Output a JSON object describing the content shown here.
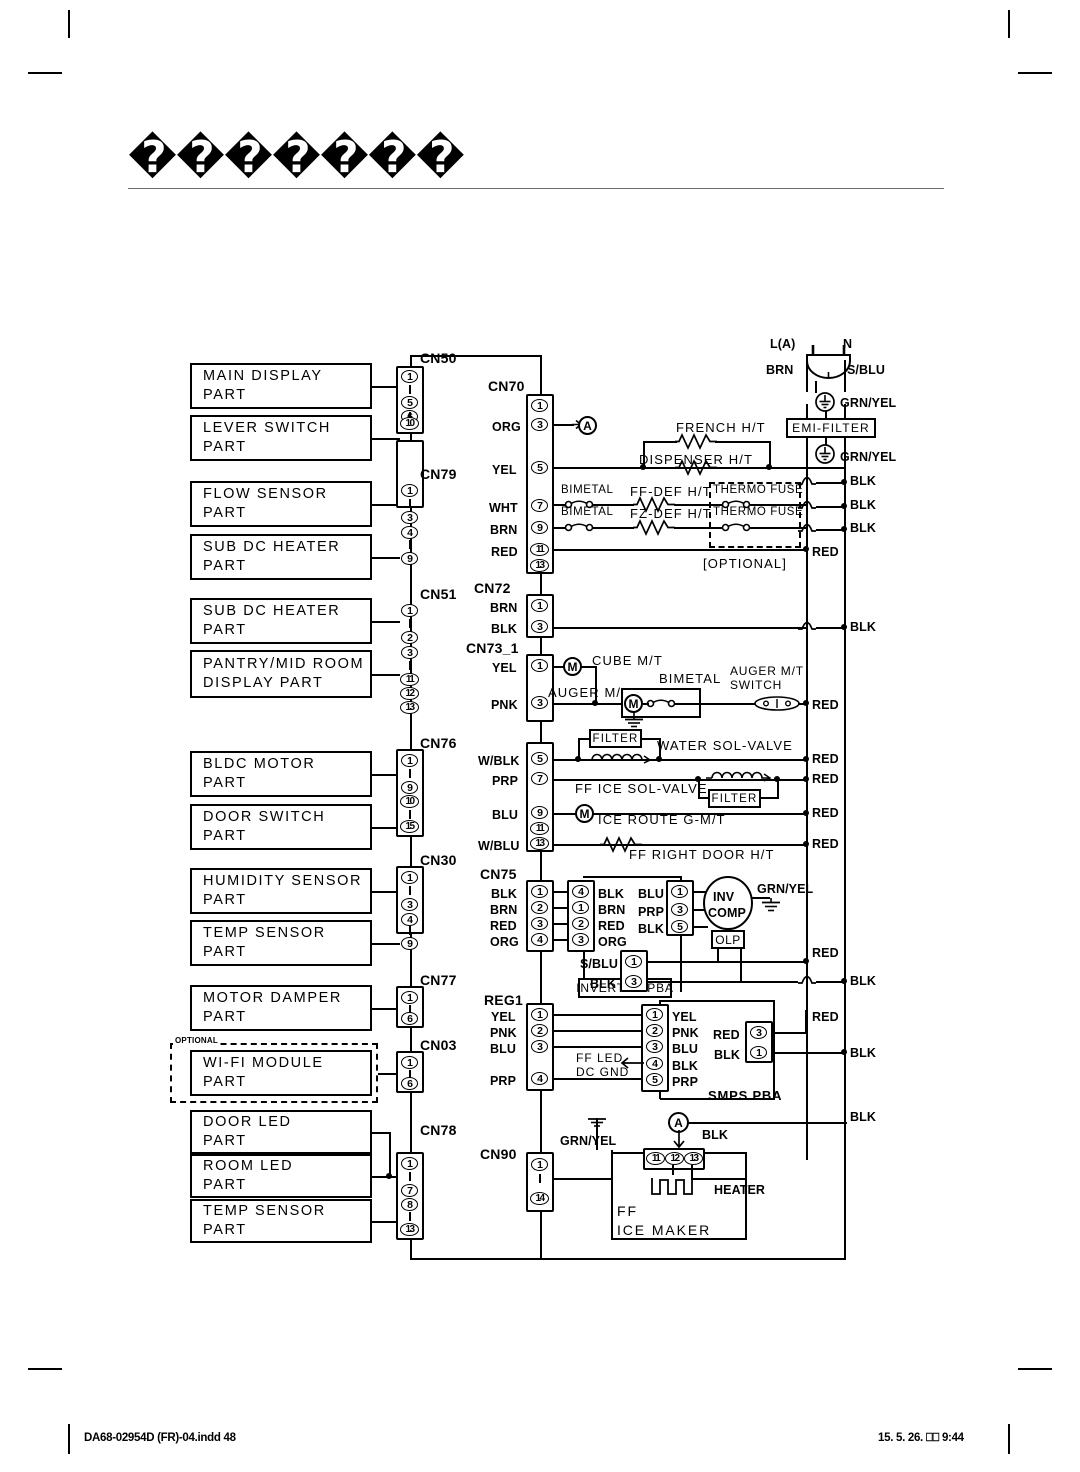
{
  "page": {
    "title": "�������",
    "footer_left": "DA68-02954D (FR)-04.indd   48",
    "footer_right": "15. 5. 26.  ⎕⎕ 9:44"
  },
  "left_parts": [
    {
      "line1": "MAIN DISPLAY",
      "line2": "PART"
    },
    {
      "line1": "LEVER SWITCH",
      "line2": "PART"
    },
    {
      "line1": "FLOW SENSOR",
      "line2": "PART"
    },
    {
      "line1": "SUB DC HEATER",
      "line2": "PART"
    },
    {
      "line1": "SUB DC HEATER",
      "line2": "PART"
    },
    {
      "line1": "PANTRY/MID ROOM",
      "line2": "DISPLAY PART"
    },
    {
      "line1": "BLDC MOTOR",
      "line2": "PART"
    },
    {
      "line1": "DOOR SWITCH",
      "line2": "PART"
    },
    {
      "line1": "HUMIDITY SENSOR",
      "line2": "PART"
    },
    {
      "line1": "TEMP SENSOR",
      "line2": "PART"
    },
    {
      "line1": "MOTOR DAMPER",
      "line2": "PART"
    },
    {
      "line1": "WI-FI MODULE",
      "line2": "PART"
    },
    {
      "line1": "DOOR LED",
      "line2": "PART"
    },
    {
      "line1": "ROOM LED",
      "line2": "PART"
    },
    {
      "line1": "TEMP SENSOR",
      "line2": "PART"
    }
  ],
  "optional_badge": "OPTIONAL",
  "left_connectors": [
    {
      "name": "CN50",
      "pins": [
        "1",
        "5",
        "6",
        "10"
      ],
      "groups": [
        [
          0,
          1
        ],
        [
          2,
          3
        ]
      ]
    },
    {
      "name": "CN79",
      "pins": [
        "1",
        "3",
        "4",
        "9"
      ],
      "groups": [
        [
          0,
          1
        ],
        [
          2,
          3
        ]
      ]
    },
    {
      "name": "CN51",
      "pins": [
        "1",
        "2",
        "3",
        "11",
        "12",
        "13"
      ],
      "groups": [
        [
          0,
          1
        ],
        [
          2,
          5
        ]
      ]
    },
    {
      "name": "CN76",
      "pins": [
        "1",
        "9",
        "10",
        "15"
      ],
      "groups": [
        [
          0,
          1
        ],
        [
          2,
          3
        ]
      ]
    },
    {
      "name": "CN30",
      "pins": [
        "1",
        "3",
        "4",
        "9"
      ],
      "groups": [
        [
          0,
          1
        ],
        [
          2,
          3
        ]
      ]
    },
    {
      "name": "CN77",
      "pins": [
        "1",
        "6"
      ],
      "groups": [
        [
          0,
          1
        ]
      ]
    },
    {
      "name": "CN03",
      "pins": [
        "1",
        "6"
      ],
      "groups": [
        [
          0,
          1
        ]
      ]
    },
    {
      "name": "CN78",
      "pins": [
        "1",
        "7",
        "8",
        "13"
      ],
      "groups": [
        [
          0,
          1
        ],
        [
          2,
          3
        ]
      ]
    }
  ],
  "right_connectors": {
    "cn70": {
      "name": "CN70",
      "pins": [
        "1",
        "3",
        "5",
        "7",
        "9",
        "11",
        "13"
      ],
      "wire_colors": [
        "",
        "ORG",
        "YEL",
        "WHT",
        "BRN",
        "RED",
        ""
      ]
    },
    "cn72": {
      "name": "CN72",
      "pins": [
        "1",
        "3"
      ],
      "wire_colors": [
        "BRN",
        "BLK"
      ]
    },
    "cn73_1": {
      "name": "CN73_1",
      "pins": [
        "1",
        "3"
      ],
      "wire_colors": [
        "YEL",
        "PNK"
      ]
    },
    "cn76r": {
      "name": "",
      "pins": [
        "5",
        "7",
        "9",
        "11",
        "13"
      ],
      "wire_colors": [
        "W/BLK",
        "PRP",
        "BLU",
        "",
        "W/BLU"
      ]
    },
    "cn75": {
      "name": "CN75",
      "pins": [
        "1",
        "2",
        "3",
        "4"
      ],
      "wire_colors": [
        "BLK",
        "BRN",
        "RED",
        "ORG"
      ]
    },
    "reg1": {
      "name": "REG1",
      "pins": [
        "1",
        "2",
        "3",
        "4"
      ],
      "wire_colors": [
        "YEL",
        "PNK",
        "BLU",
        "PRP"
      ]
    },
    "cn90": {
      "name": "CN90",
      "pins": [
        "1",
        "14"
      ],
      "wire_colors": [
        "",
        ""
      ]
    }
  },
  "power_inlet": {
    "terminal_left": "L(A)",
    "terminal_right": "N",
    "wire_left": "BRN",
    "wire_right": "S/BLU",
    "ground_upper": "GRN/YEL",
    "ground_lower": "GRN/YEL",
    "emi_filter": "EMI-FILTER"
  },
  "heater_circuit": {
    "french_ht": "FRENCH H/T",
    "dispenser_ht": "DISPENSER H/T",
    "bimetal_1": "BIMETAL",
    "ff_def_ht": "FF-DEF H/T",
    "thermo_fuse_1": "THERMO FUSE",
    "bimetal_2": "BIMETAL",
    "fz_def_ht": "FZ-DEF H/T",
    "thermo_fuse_2": "THERMO FUSE",
    "optional_note": "[OPTIONAL]",
    "rail_labels": [
      "BLK",
      "BLK",
      "BLK",
      "RED"
    ]
  },
  "ice_circuit": {
    "cube_mt": "CUBE M/T",
    "auger_mt": "AUGER M/T",
    "bimetal": "BIMETAL",
    "auger_switch_1": "AUGER M/T",
    "auger_switch_2": "SWITCH",
    "filter_1": "FILTER",
    "filter_2": "FILTER",
    "water_sol_valve": "WATER SOL-VALVE",
    "ff_ice_sol_valve": "FF ICE SOL-VALVE",
    "ice_route_gmt": "ICE ROUTE G-M/T",
    "ff_right_door_ht": "FF RIGHT DOOR H/T",
    "motor_glyph": "M",
    "rail_red": "RED",
    "rail_blk": "BLK"
  },
  "inverter": {
    "title": "INVERTER PBA",
    "in_pins": [
      "4",
      "1",
      "2",
      "3"
    ],
    "in_colors": [
      "BLK",
      "BRN",
      "RED",
      "ORG"
    ],
    "out_pins": [
      "1",
      "3",
      "5"
    ],
    "out_colors": [
      "BLU",
      "PRP",
      "BLK"
    ],
    "comp_line1": "INV",
    "comp_line2": "COMP",
    "comp_ground": "GRN/YEL",
    "olp": "OLP",
    "ac_pins": [
      "1",
      "3"
    ],
    "ac_colors": [
      "S/BLU",
      "BLK"
    ],
    "rail_red": "RED",
    "rail_blk": "BLK"
  },
  "smps": {
    "title": "SMPS PBA",
    "in_pins": [
      "1",
      "2",
      "3",
      "4",
      "5"
    ],
    "in_colors": [
      "YEL",
      "PNK",
      "BLU",
      "BLK",
      "PRP"
    ],
    "ff_led": "FF LED",
    "dc_gnd": "DC GND",
    "out_pins": [
      "3",
      "1"
    ],
    "out_colors": [
      "RED",
      "BLK"
    ],
    "rail_red": "RED",
    "rail_blk": "BLK"
  },
  "ice_maker": {
    "title_line1": "FF",
    "title_line2": "ICE MAKER",
    "pins": [
      "11",
      "12",
      "13"
    ],
    "ground_label": "GRN/YEL",
    "black_label": "BLK",
    "heater": "HEATER",
    "a_marker": "A",
    "rail_blk": "BLK"
  },
  "markers": {
    "a_top": "A",
    "a_bottom": "A"
  },
  "colors": {
    "ink": "#000000",
    "paper": "#ffffff",
    "rule": "#6b6b6b"
  }
}
